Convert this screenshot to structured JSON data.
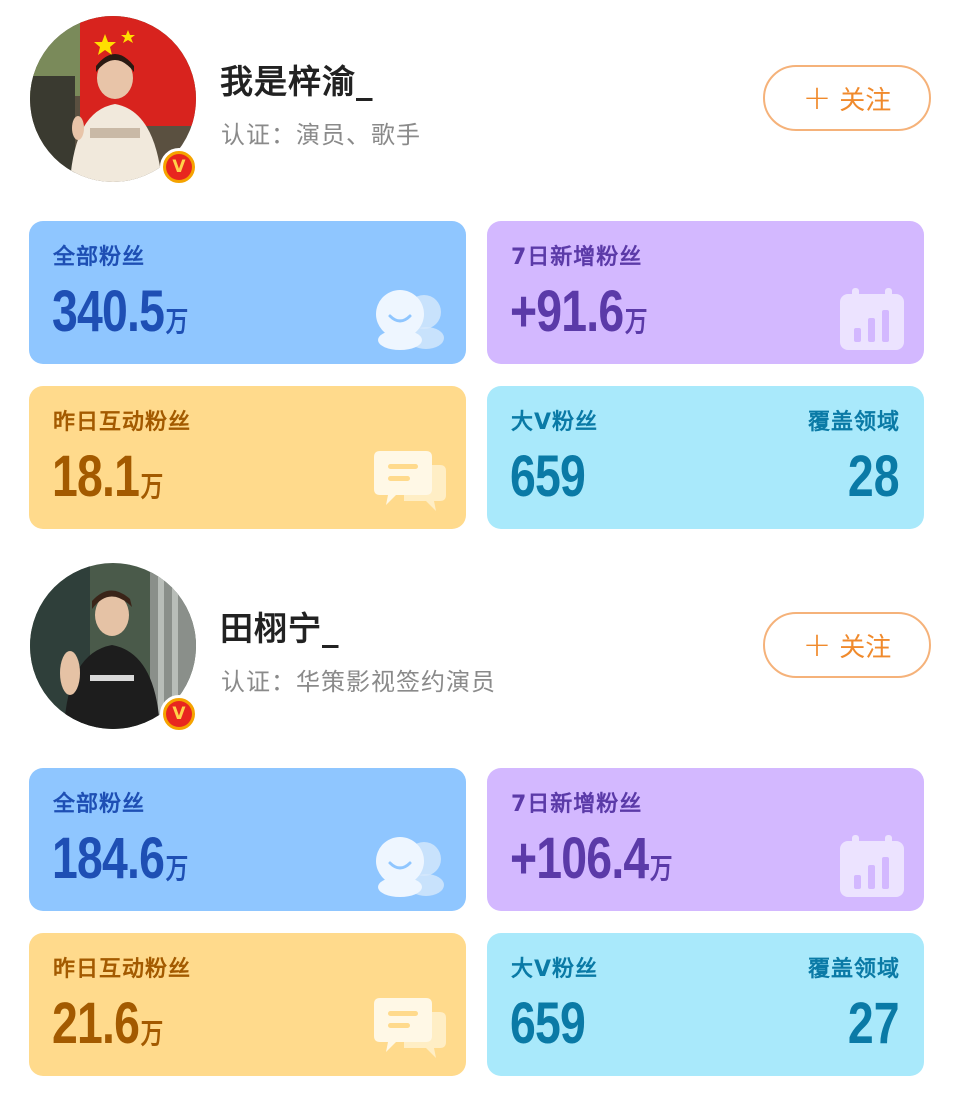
{
  "follow_label": "关注",
  "units": {
    "wan": "万"
  },
  "stat_labels": {
    "fans": "全部粉丝",
    "new7": "7日新增粉丝",
    "active": "昨日互动粉丝",
    "bigv": "大V粉丝",
    "domains": "覆盖领域"
  },
  "profiles": [
    {
      "name": "我是梓渝_",
      "cert": "认证：演员、歌手",
      "verified_badge": "V",
      "fans": "340.5",
      "new7": "+91.6",
      "active": "18.1",
      "bigv": "659",
      "domains": "28"
    },
    {
      "name": "田栩宁_",
      "cert": "认证：华策影视签约演员",
      "verified_badge": "V",
      "fans": "184.6",
      "new7": "+106.4",
      "active": "21.6",
      "bigv": "659",
      "domains": "27"
    }
  ],
  "colors": {
    "accent_orange": "#f08a2c",
    "fans_card": "#8fc6ff",
    "new_card": "#d3b8ff",
    "active_card": "#ffda8c",
    "bigv_card": "#a9e9fb"
  },
  "icons": {
    "fans": "people-icon",
    "new7": "bar-calendar-icon",
    "active": "chat-bubble-icon",
    "follow": "plus-icon",
    "verified": "verified-v-icon"
  }
}
